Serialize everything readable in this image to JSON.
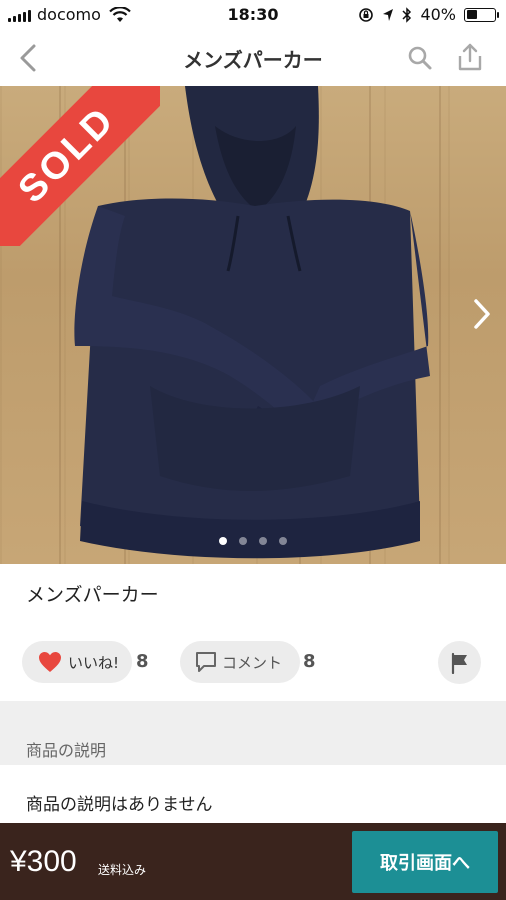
{
  "status_bar": {
    "carrier": "docomo",
    "time": "18:30",
    "battery": "40%",
    "battery_level": 0.4
  },
  "nav": {
    "title": "メンズパーカー",
    "icons": [
      "back-chevron-icon",
      "search-icon",
      "share-icon"
    ]
  },
  "photo": {
    "badge": "SOLD",
    "badge_color": "#e8473e",
    "page_count": 4,
    "current_page": 1
  },
  "item": {
    "name": "メンズパーカー"
  },
  "actions": {
    "like_label": "いいね!",
    "like_count": "8",
    "comment_label": "コメント",
    "comment_count": "8",
    "like_color": "#e8473e"
  },
  "description": {
    "header": "商品の説明",
    "body": "商品の説明はありません"
  },
  "footer": {
    "price": "¥300",
    "shipping": "送料込み",
    "trade_button": "取引画面へ",
    "bar_color": "#3a241d",
    "button_color": "#1c8f95"
  }
}
